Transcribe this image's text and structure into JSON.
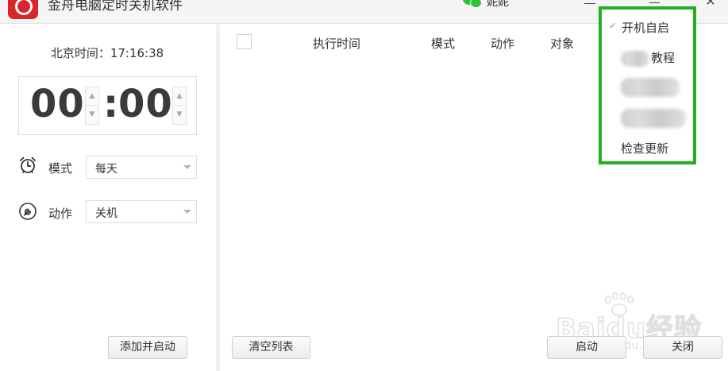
{
  "window": {
    "title": "金舟电脑定时关机软件",
    "user_name": "妮妮"
  },
  "clock": {
    "beijing_time_label": "北京时间：17:16:38",
    "hour": "00",
    "colon": ":",
    "minute": "00",
    "up_glyph": "▲",
    "down_glyph": "▼"
  },
  "options": {
    "mode_label": "模式",
    "mode_value": "每天",
    "action_label": "动作",
    "action_value": "关机"
  },
  "buttons": {
    "add_and_start": "添加并启动",
    "clear_list": "清空列表",
    "start": "启动",
    "close": "关闭"
  },
  "table": {
    "columns": [
      "执行时间",
      "模式",
      "动作",
      "对象"
    ],
    "rows": []
  },
  "popup_menu": {
    "autostart": "开机自启",
    "autostart_checked": true,
    "tutorial_suffix": "教程",
    "check_update": "检查更新",
    "check_glyph": "✓"
  },
  "titlebar": {
    "close_glyph": "✕"
  },
  "watermark": {
    "text": "Baidu经验",
    "url": "jingyan.baidu.com"
  },
  "colors": {
    "highlight_border": "#20b020",
    "logo_red": "#d8262b",
    "wechat_green": "#2ec23a"
  }
}
